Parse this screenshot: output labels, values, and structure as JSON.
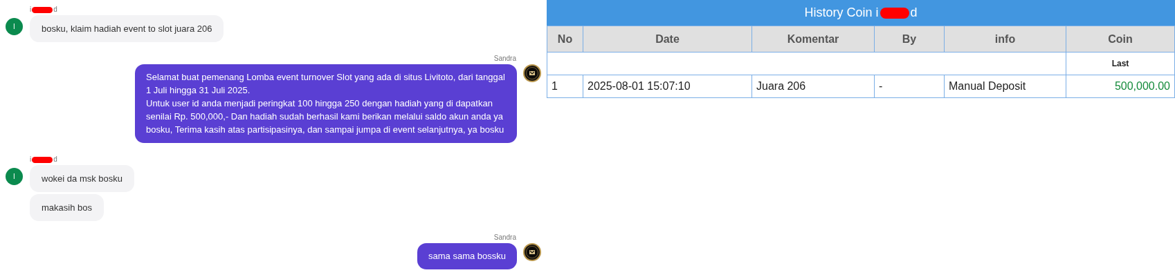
{
  "chat": [
    {
      "kind": "incoming",
      "sender": "i",
      "sender_end": "d",
      "avatar_letter": "I",
      "bubbles": [
        "bosku, klaim hadiah event to slot juara 206"
      ]
    },
    {
      "kind": "outgoing",
      "sender": "Sandra",
      "bubbles": [
        "Selamat buat pemenang Lomba event turnover Slot yang ada di situs Livitoto, dari tanggal 1 Juli hingga 31 Juli 2025.\nUntuk user id anda menjadi peringkat 100 hingga 250 dengan hadiah yang di dapatkan senilai Rp. 500,000,- Dan hadiah sudah berhasil kami berikan melalui saldo akun anda ya bosku, Terima kasih atas partisipasinya, dan sampai jumpa di event selanjutnya, ya bosku"
      ]
    },
    {
      "kind": "incoming",
      "sender": "i",
      "sender_end": "d",
      "avatar_letter": "I",
      "bubbles": [
        "wokei da msk bosku",
        "makasih bos"
      ]
    },
    {
      "kind": "outgoing",
      "sender": "Sandra",
      "bubbles": [
        "sama sama bossku"
      ]
    }
  ],
  "history": {
    "title": "History Coin i",
    "title_end": "d",
    "columns": [
      "No",
      "Date",
      "Komentar",
      "By",
      "info",
      "Coin"
    ],
    "subheader": "Last",
    "rows": [
      {
        "cells": [
          "1",
          "2025-08-01 15:07:10",
          "Juara 206",
          "-",
          "Manual Deposit",
          "500,000.00"
        ]
      }
    ]
  }
}
